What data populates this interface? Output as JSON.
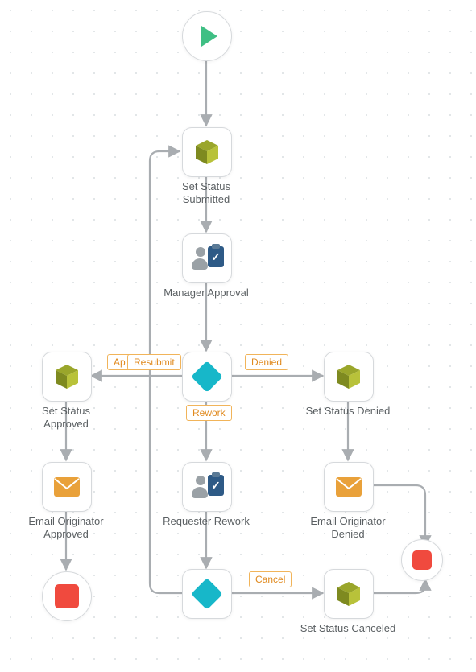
{
  "colors": {
    "accent_green": "#3fbf84",
    "accent_olive": "#9aa62b",
    "accent_teal": "#17b7c9",
    "accent_orange": "#e9a13a",
    "accent_red": "#f04a3e",
    "accent_navy": "#2e5a86",
    "label": "#5b6063",
    "edge_border": "#f1b45a",
    "edge_text": "#e08a1f"
  },
  "nodes": {
    "start": {
      "label": ""
    },
    "set_status_submitted": {
      "label": "Set Status\nSubmitted"
    },
    "manager_approval": {
      "label": "Manager Approval"
    },
    "decision1": {
      "label": ""
    },
    "set_status_approved": {
      "label": "Set Status\nApproved"
    },
    "set_status_denied": {
      "label": "Set Status Denied"
    },
    "requester_rework": {
      "label": "Requester Rework"
    },
    "email_originator_approved": {
      "label": "Email Originator\nApproved"
    },
    "email_originator_denied": {
      "label": "Email Originator\nDenied"
    },
    "decision2": {
      "label": ""
    },
    "set_status_canceled": {
      "label": "Set Status Canceled"
    },
    "end_left": {
      "label": ""
    },
    "end_right": {
      "label": ""
    }
  },
  "edge_labels": {
    "approved": "Ap",
    "resubmit": "Resubmit",
    "denied": "Denied",
    "rework": "Rework",
    "cancel": "Cancel"
  }
}
